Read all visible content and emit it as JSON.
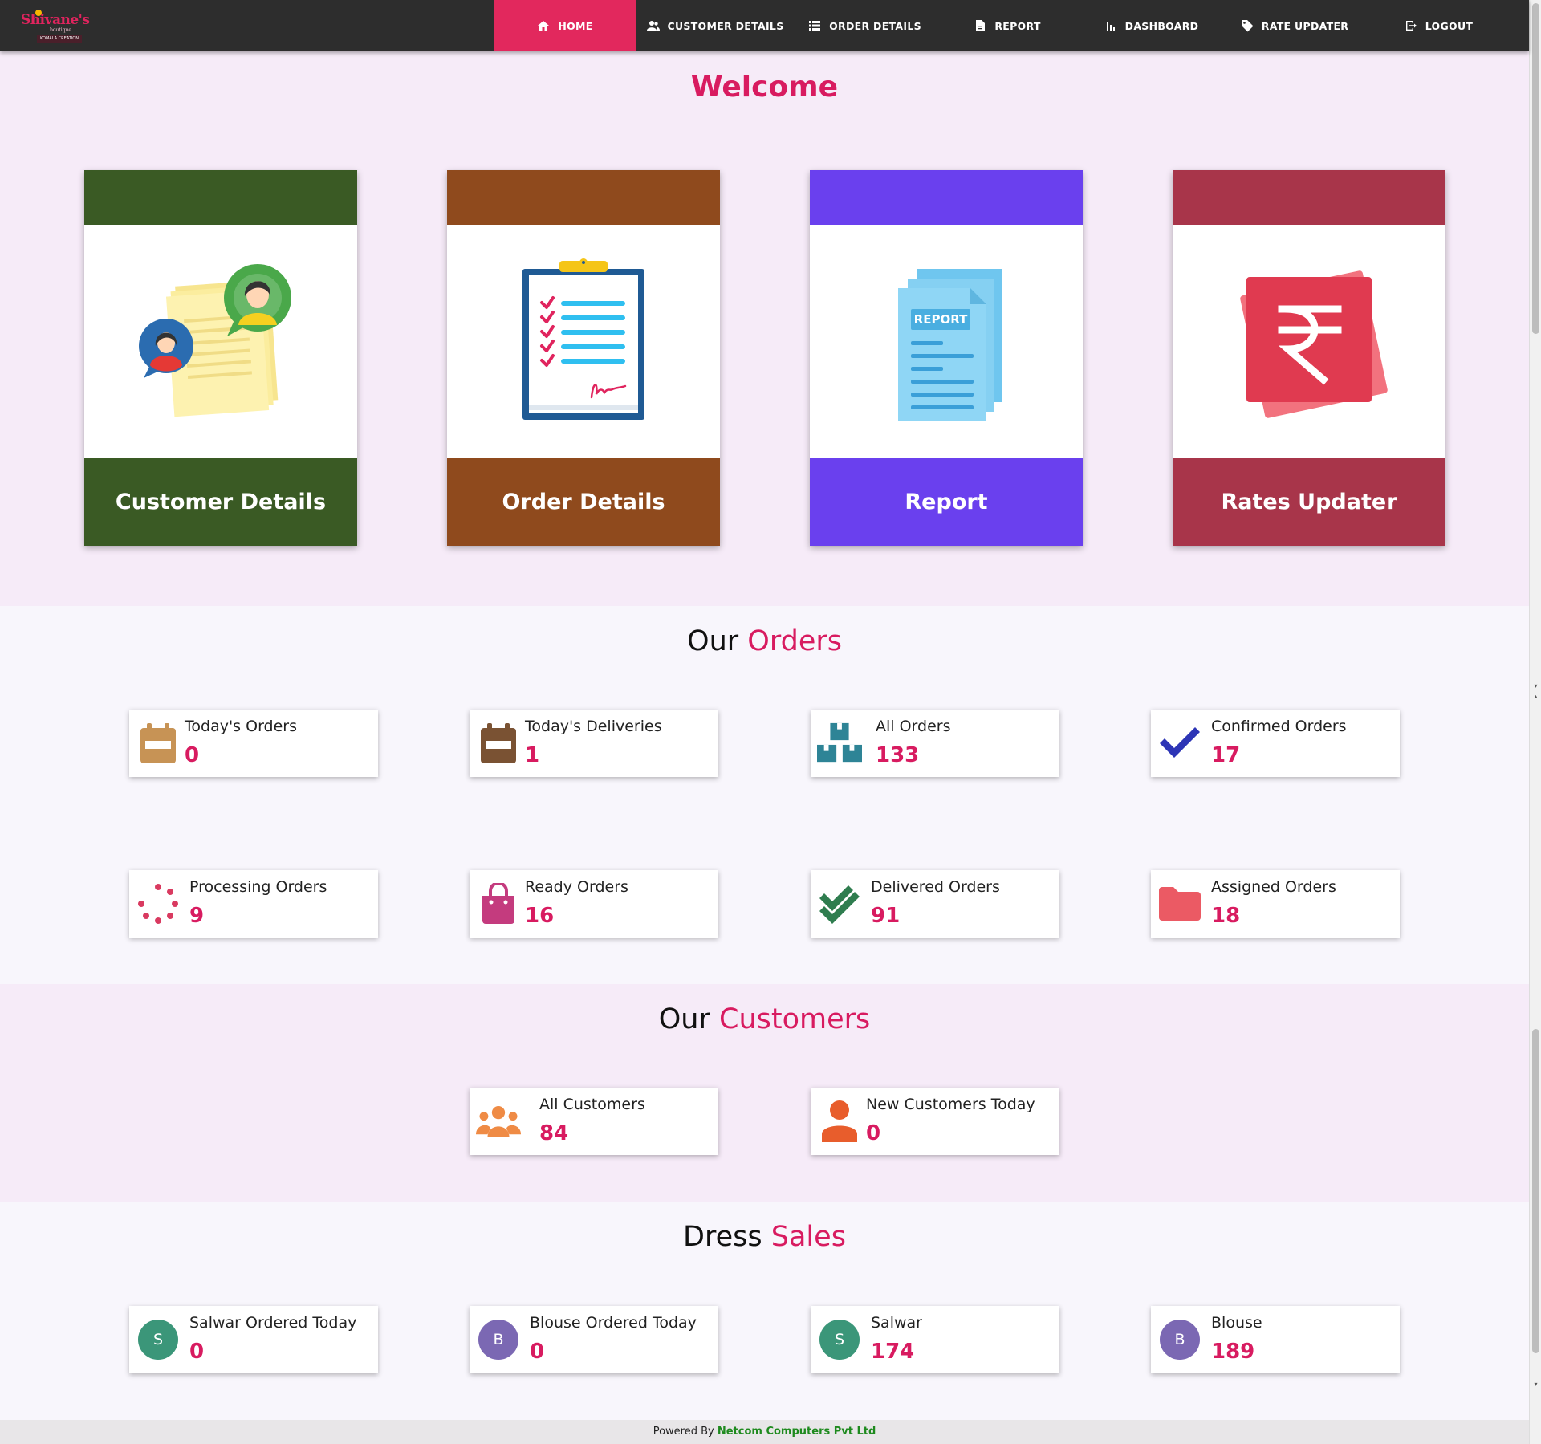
{
  "app": {
    "logo_text": "Shivane's",
    "logo_sub": "boutique",
    "logo_tag": "KOMALA CREATION"
  },
  "nav": {
    "items": [
      {
        "label": "HOME",
        "icon": "home-icon"
      },
      {
        "label": "CUSTOMER DETAILS",
        "icon": "people-icon"
      },
      {
        "label": "ORDER DETAILS",
        "icon": "list-icon"
      },
      {
        "label": "REPORT",
        "icon": "document-icon"
      },
      {
        "label": "DASHBOARD",
        "icon": "bar-chart-icon"
      },
      {
        "label": "RATE UPDATER",
        "icon": "tag-icon"
      },
      {
        "label": "LOGOUT",
        "icon": "logout-icon"
      }
    ],
    "active": "HOME"
  },
  "welcome": {
    "title": "Welcome",
    "cards": [
      {
        "label": "Customer Details",
        "color": "#3a5a24",
        "icon": "customer-documents-icon"
      },
      {
        "label": "Order Details",
        "color": "#8f4a1d",
        "icon": "clipboard-checklist-icon"
      },
      {
        "label": "Report",
        "color": "#6a40ee",
        "icon": "report-documents-icon"
      },
      {
        "label": "Rates Updater",
        "color": "#a8354a",
        "icon": "rupee-icon"
      }
    ]
  },
  "orders": {
    "title_prefix": "Our",
    "title_accent": "Orders",
    "stats": [
      {
        "label": "Today's Orders",
        "value": "0",
        "icon": "calendar-icon"
      },
      {
        "label": "Today's Deliveries",
        "value": "1",
        "icon": "calendar-icon"
      },
      {
        "label": "All Orders",
        "value": "133",
        "icon": "boxes-icon"
      },
      {
        "label": "Confirmed Orders",
        "value": "17",
        "icon": "checkmark-icon"
      },
      {
        "label": "Processing Orders",
        "value": "9",
        "icon": "spinner-icon"
      },
      {
        "label": "Ready Orders",
        "value": "16",
        "icon": "shopping-bag-icon"
      },
      {
        "label": "Delivered Orders",
        "value": "91",
        "icon": "double-check-icon"
      },
      {
        "label": "Assigned Orders",
        "value": "18",
        "icon": "folder-icon"
      }
    ]
  },
  "customers": {
    "title_prefix": "Our",
    "title_accent": "Customers",
    "stats": [
      {
        "label": "All Customers",
        "value": "84",
        "icon": "group-icon"
      },
      {
        "label": "New Customers Today",
        "value": "0",
        "icon": "person-icon"
      }
    ]
  },
  "sales": {
    "title_prefix": "Dress",
    "title_accent": "Sales",
    "stats": [
      {
        "label": "Salwar Ordered Today",
        "value": "0",
        "avatar": "S",
        "avatar_color": "#3b9679"
      },
      {
        "label": "Blouse Ordered Today",
        "value": "0",
        "avatar": "B",
        "avatar_color": "#7b68b3"
      },
      {
        "label": "Salwar",
        "value": "174",
        "avatar": "S",
        "avatar_color": "#3b9679"
      },
      {
        "label": "Blouse",
        "value": "189",
        "avatar": "B",
        "avatar_color": "#7b68b3"
      }
    ]
  },
  "footer": {
    "prefix": "Powered By",
    "company": "Netcom Computers Pvt Ltd"
  },
  "colors": {
    "accent": "#d81b60",
    "nav_bg": "#2d2d2d",
    "nav_active": "#e2285d"
  }
}
